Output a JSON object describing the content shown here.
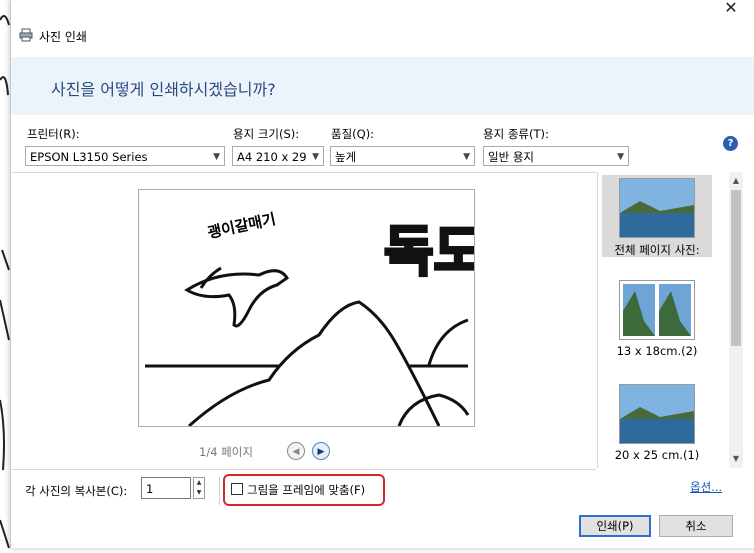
{
  "window": {
    "title": "사진 인쇄",
    "close_glyph": "✕",
    "header": "사진을 어떻게 인쇄하시겠습니까?"
  },
  "settings": {
    "printer_label": "프린터(R):",
    "printer_value": "EPSON L3150 Series",
    "paper_size_label": "용지 크기(S):",
    "paper_size_value": "A4 210 x 29",
    "quality_label": "품질(Q):",
    "quality_value": "높게",
    "paper_type_label": "용지 종류(T):",
    "paper_type_value": "일반 용지",
    "help_glyph": "?"
  },
  "preview": {
    "page_indicator": "1/4 페이지",
    "prev_glyph": "◀",
    "next_glyph": "▶",
    "image_text_small": "괭이갈매기",
    "image_text_large": "독도"
  },
  "layouts": [
    {
      "label": "전체 페이지 사진:",
      "selected": true
    },
    {
      "label": "13 x 18cm.(2)",
      "selected": false
    },
    {
      "label": "20 x 25 cm.(1)",
      "selected": false
    }
  ],
  "footer": {
    "copies_label": "각 사진의 복사본(C):",
    "copies_value": "1",
    "fit_label": "그림을 프레임에 맞춤(F)",
    "fit_checked": false,
    "options_link": "옵션...",
    "print_button": "인쇄(P)",
    "cancel_button": "취소"
  },
  "colors": {
    "header_band": "#edf3fb",
    "header_text": "#2a4b7e",
    "highlight": "#d62828",
    "link": "#1a56b8"
  }
}
